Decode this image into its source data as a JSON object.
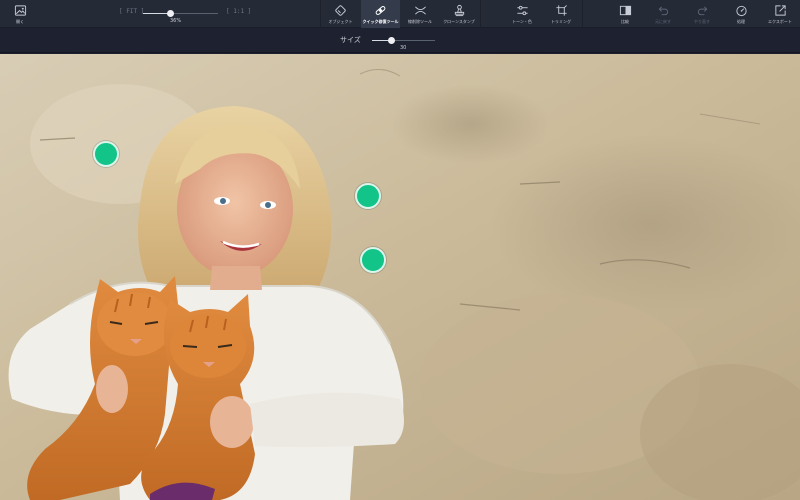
{
  "toolbar": {
    "open_label": "開く",
    "zoom": {
      "fit_label": "[ FIT ]",
      "one_label": "[ 1:1 ]",
      "value_text": "36%",
      "value": 0.36
    },
    "tools": [
      {
        "label": "オブジェクト"
      },
      {
        "label": "クイック修復ツール"
      },
      {
        "label": "線削除ツール"
      },
      {
        "label": "クローンスタンプ"
      },
      {
        "label": "トーン・色"
      },
      {
        "label": "トリミング"
      }
    ],
    "compare_label": "比較",
    "undo_label": "元に戻す",
    "redo_label": "やり直す",
    "process_label": "処理",
    "export_label": "エクスポート"
  },
  "subbar": {
    "size_label": "サイズ",
    "size_value_text": "30",
    "size_value": 0.3
  },
  "colors": {
    "accent": "#12c488",
    "toolbar": "#252a37",
    "subbar": "#1e2230"
  },
  "icons": {
    "open": "image-icon",
    "object": "eraser-icon",
    "quick_repair": "bandage-icon",
    "line_remove": "line-cross-icon",
    "clone": "stamp-icon",
    "tone": "sliders-icon",
    "crop": "crop-icon",
    "compare": "split-view-icon",
    "undo": "undo-icon",
    "redo": "redo-icon",
    "process": "gauge-icon",
    "export": "export-icon"
  },
  "canvas": {
    "markers": 3
  }
}
